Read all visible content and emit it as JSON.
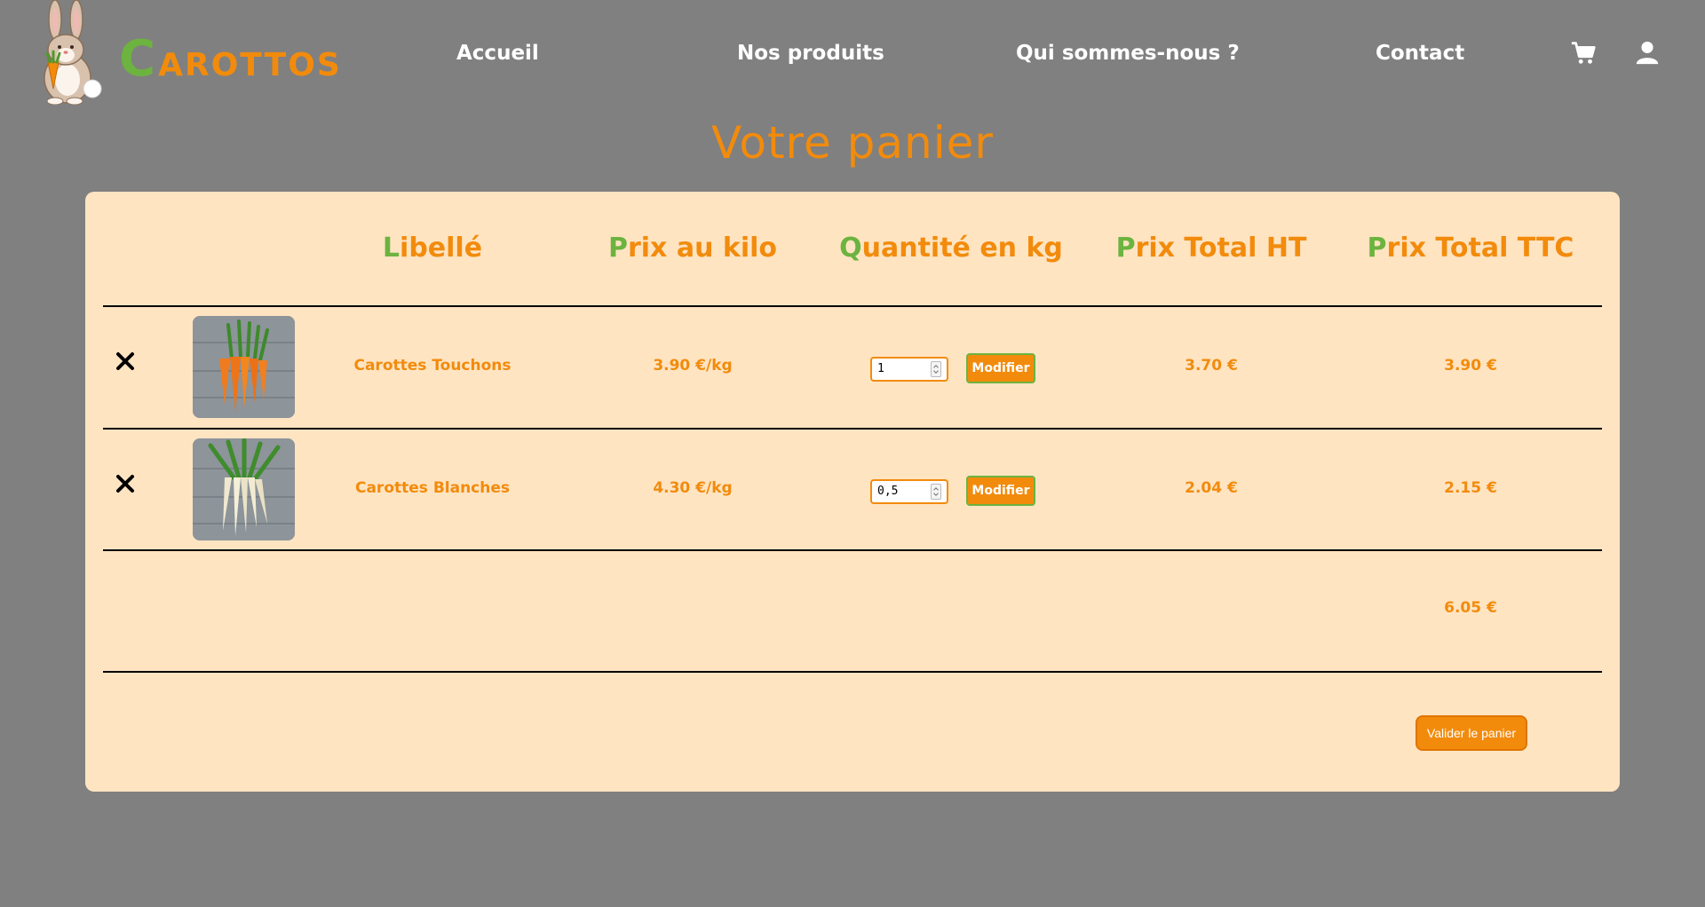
{
  "brand": {
    "initial": "C",
    "rest": "AROTTOS",
    "mascot_icon": "rabbit-holding-carrot-icon",
    "colors": {
      "orange": "#f28b0c",
      "green": "#6cb33f",
      "panel": "#ffe4c2",
      "background": "#808080"
    }
  },
  "nav": {
    "links": [
      "Accueil",
      "Nos produits",
      "Qui sommes-nous ?",
      "Contact"
    ],
    "icons": [
      "shopping-cart-icon",
      "user-icon"
    ]
  },
  "page_title": "Votre panier",
  "table": {
    "headers": [
      {
        "first": "L",
        "rest": "ibellé"
      },
      {
        "first": "P",
        "rest": "rix au kilo"
      },
      {
        "first": "Q",
        "rest": "uantité en kg"
      },
      {
        "first": "P",
        "rest": "rix Total HT"
      },
      {
        "first": "P",
        "rest": "rix Total TTC"
      }
    ],
    "rows": [
      {
        "remove_icon": "remove-x-icon",
        "image": "orange-carrots-bunch",
        "libelle": "Carottes Touchons",
        "prix_kilo": "3.90 €/kg",
        "quantite": "1",
        "modify_label": "Modifier",
        "total_ht": "3.70 €",
        "total_ttc": "3.90 €"
      },
      {
        "remove_icon": "remove-x-icon",
        "image": "white-carrots-bunch",
        "libelle": "Carottes Blanches",
        "prix_kilo": "4.30 €/kg",
        "quantite": "0,5",
        "modify_label": "Modifier",
        "total_ht": "2.04 €",
        "total_ttc": "2.15 €"
      }
    ],
    "grand_total_ttc": "6.05 €"
  },
  "validate_label": "Valider le panier"
}
